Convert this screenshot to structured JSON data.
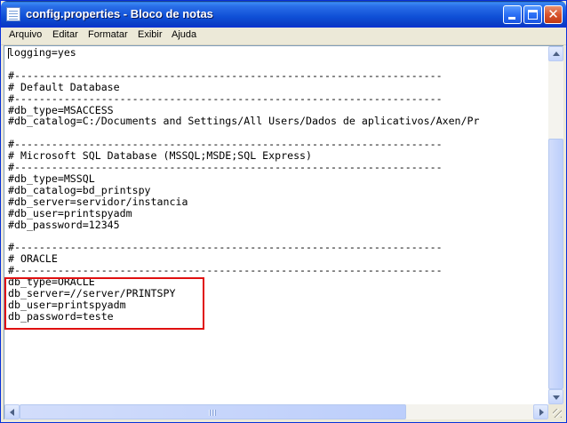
{
  "window": {
    "title": "config.properties - Bloco de notas",
    "colors": {
      "titlebar": "#0a3cc4",
      "close_button": "#d8542e",
      "highlight_border": "#e01010"
    }
  },
  "menubar": {
    "items": [
      "Arquivo",
      "Editar",
      "Formatar",
      "Exibir",
      "Ajuda"
    ]
  },
  "editor": {
    "lines": [
      "logging=yes",
      "",
      "#---------------------------------------------------------------------",
      "# Default Database",
      "#---------------------------------------------------------------------",
      "#db_type=MSACCESS",
      "#db_catalog=C:/Documents and Settings/All Users/Dados de aplicativos/Axen/Pr",
      "",
      "#---------------------------------------------------------------------",
      "# Microsoft SQL Database (MSSQL;MSDE;SQL Express)",
      "#---------------------------------------------------------------------",
      "#db_type=MSSQL",
      "#db_catalog=bd_printspy",
      "#db_server=servidor/instancia",
      "#db_user=printspyadm",
      "#db_password=12345",
      "",
      "#---------------------------------------------------------------------",
      "# ORACLE",
      "#---------------------------------------------------------------------",
      "db_type=ORACLE",
      "db_server=//server/PRINTSPY",
      "db_user=printspyadm",
      "db_password=teste"
    ],
    "highlighted_lines": [
      "db_type=ORACLE",
      "db_server=//server/PRINTSPY",
      "db_user=printspyadm",
      "db_password=teste"
    ]
  },
  "icons": {
    "app": "notepad-icon",
    "minimize": "minimize-icon",
    "maximize": "maximize-icon",
    "close": "close-icon",
    "scroll_up": "arrow-up-icon",
    "scroll_down": "arrow-down-icon",
    "scroll_left": "arrow-left-icon",
    "scroll_right": "arrow-right-icon"
  }
}
